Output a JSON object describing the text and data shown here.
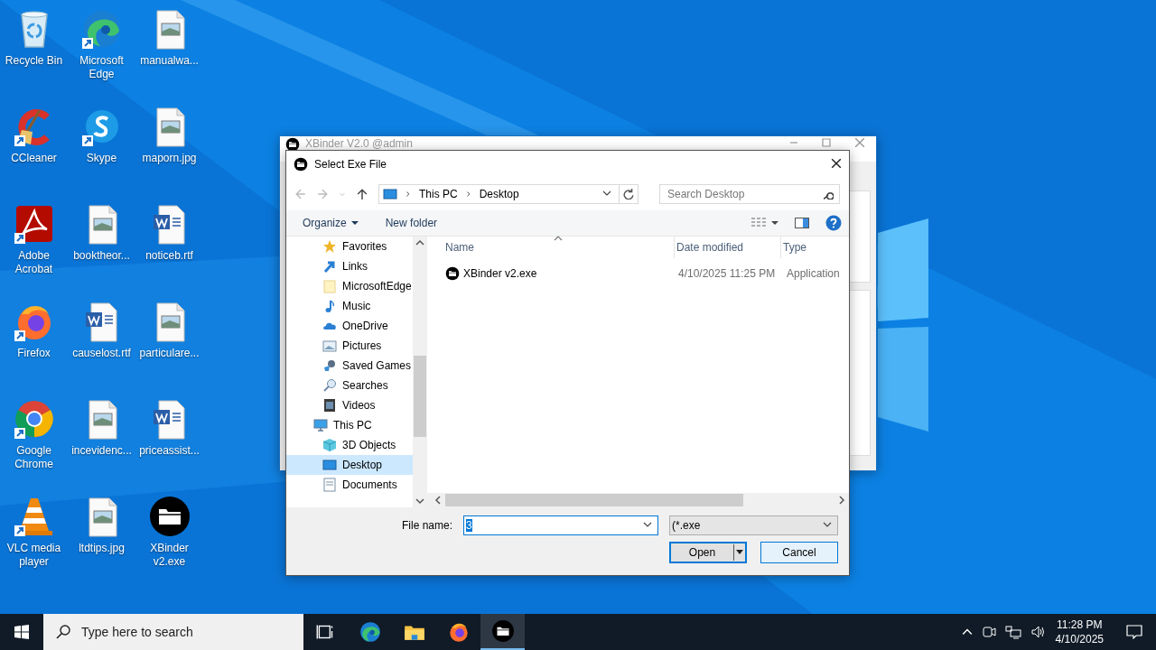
{
  "desktop": {
    "icons": [
      {
        "label": "Recycle Bin",
        "kind": "recycle",
        "shortcut": false
      },
      {
        "label": "CCleaner",
        "kind": "cleaner",
        "shortcut": true
      },
      {
        "label": "Adobe Acrobat",
        "kind": "pdf",
        "shortcut": true
      },
      {
        "label": "Firefox",
        "kind": "firefox",
        "shortcut": true
      },
      {
        "label": "Google Chrome",
        "kind": "chrome",
        "shortcut": true
      },
      {
        "label": "VLC media player",
        "kind": "cone",
        "shortcut": true
      },
      {
        "label": "Microsoft Edge",
        "kind": "edge",
        "shortcut": true
      },
      {
        "label": "Skype",
        "kind": "chat",
        "shortcut": true
      },
      {
        "label": "booktheor...",
        "kind": "image",
        "shortcut": false
      },
      {
        "label": "causelost.rtf",
        "kind": "word",
        "shortcut": false
      },
      {
        "label": "incevidenc...",
        "kind": "image",
        "shortcut": false
      },
      {
        "label": "ltdtips.jpg",
        "kind": "image",
        "shortcut": false
      },
      {
        "label": "manualwa...",
        "kind": "image",
        "shortcut": false
      },
      {
        "label": "maporn.jpg",
        "kind": "image",
        "shortcut": false
      },
      {
        "label": "noticeb.rtf",
        "kind": "word",
        "shortcut": false
      },
      {
        "label": "particulare...",
        "kind": "image",
        "shortcut": false
      },
      {
        "label": "priceassist...",
        "kind": "word",
        "shortcut": false
      },
      {
        "label": "XBinder v2.exe",
        "kind": "app",
        "shortcut": false
      }
    ]
  },
  "background_window": {
    "title": "XBinder V2.0 @admin"
  },
  "dialog": {
    "title": "Select Exe File",
    "address": [
      "This PC",
      "Desktop"
    ],
    "search_placeholder": "Search Desktop",
    "organize": "Organize",
    "new_folder": "New folder",
    "tree": [
      {
        "label": "Favorites",
        "kind": "star",
        "selected": false
      },
      {
        "label": "Links",
        "kind": "link",
        "selected": false
      },
      {
        "label": "MicrosoftEdge",
        "kind": "folder",
        "selected": false
      },
      {
        "label": "Music",
        "kind": "music",
        "selected": false
      },
      {
        "label": "OneDrive",
        "kind": "cloud",
        "selected": false
      },
      {
        "label": "Pictures",
        "kind": "pictures",
        "selected": false
      },
      {
        "label": "Saved Games",
        "kind": "games",
        "selected": false
      },
      {
        "label": "Searches",
        "kind": "search",
        "selected": false
      },
      {
        "label": "Videos",
        "kind": "videos",
        "selected": false
      },
      {
        "label": "This PC",
        "kind": "computer",
        "selected": false,
        "children": [
          {
            "label": "3D Objects",
            "kind": "cube",
            "selected": false
          },
          {
            "label": "Desktop",
            "kind": "desktop",
            "selected": true
          },
          {
            "label": "Documents",
            "kind": "documents",
            "selected": false
          }
        ]
      }
    ],
    "columns": [
      "Name",
      "Date modified",
      "Type"
    ],
    "files": [
      {
        "name": "XBinder v2.exe",
        "date": "4/10/2025 11:25 PM",
        "type": "Application",
        "selected": false
      }
    ],
    "file_name_label": "File name:",
    "file_name": {
      "value": "3",
      "text_selected": true
    },
    "filter": "(*.exe",
    "buttons": [
      {
        "label": "Open",
        "kind": "split",
        "default": true
      },
      {
        "label": "Cancel",
        "kind": "plain",
        "default": false
      }
    ]
  },
  "taskbar": {
    "search_placeholder": "Type here to search",
    "apps": [
      {
        "kind": "taskview",
        "active": false
      },
      {
        "kind": "edge",
        "active": false
      },
      {
        "kind": "explorer",
        "active": false
      },
      {
        "kind": "firefox",
        "active": false
      },
      {
        "kind": "app",
        "active": true
      }
    ],
    "time": "11:28 PM",
    "date": "4/10/2025"
  }
}
